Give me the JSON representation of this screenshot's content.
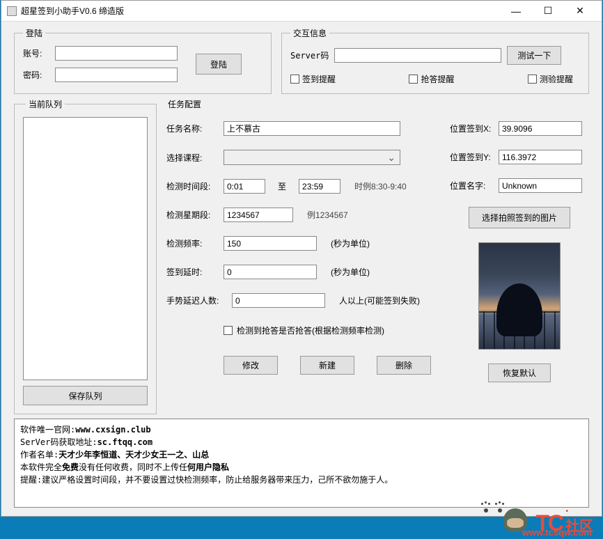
{
  "titlebar": {
    "title": "超星签到小助手V0.6 缔造版"
  },
  "login": {
    "legend": "登陆",
    "account_label": "账号:",
    "password_label": "密码:",
    "login_btn": "登陆"
  },
  "interact": {
    "legend": "交互信息",
    "server_label": "Server码",
    "test_btn": "测试一下",
    "chk_signin": "签到提醒",
    "chk_answer": "抢答提醒",
    "chk_test": "测验提醒"
  },
  "queue": {
    "legend": "当前队列",
    "save_btn": "保存队列"
  },
  "task": {
    "legend": "任务配置",
    "name_label": "任务名称:",
    "name_value": "上不慕古",
    "course_label": "选择课程:",
    "time_label": "检测时间段:",
    "time_start": "0:01",
    "time_to": "至",
    "time_end": "23:59",
    "time_example": "时例8:30-9:40",
    "weekday_label": "检测星期段:",
    "weekday_value": "1234567",
    "weekday_example": "例1234567",
    "freq_label": "检测频率:",
    "freq_value": "150",
    "freq_unit": "(秒为单位)",
    "delay_label": "签到延时:",
    "delay_value": "0",
    "delay_unit": "(秒为单位)",
    "count_label": "手势延迟人数:",
    "count_value": "0",
    "count_suffix": "人以上(可能签到失败)",
    "auto_answer": "检测到抢答是否抢答(根据检测频率检测)",
    "btn_modify": "修改",
    "btn_new": "新建",
    "btn_delete": "删除"
  },
  "position": {
    "x_label": "位置签到X:",
    "x_value": "39.9096",
    "y_label": "位置签到Y:",
    "y_value": "116.3972",
    "name_label": "位置名字:",
    "name_value": "Unknown",
    "photo_btn": "选择拍照签到的图片",
    "restore_btn": "恢复默认"
  },
  "info": {
    "line1_prefix": "软件唯一官网:",
    "line1_url": "www.cxsign.club",
    "line2_prefix": "SerVer码获取地址:",
    "line2_url": "sc.ftqq.com",
    "line3_prefix": "作者名单:",
    "line3_names": "天才少年李恒道、天才少女王一之、山总",
    "line4_a": "本软件完全",
    "line4_b": "免费",
    "line4_c": "没有任何收费，同时不上传任",
    "line4_d": "何用户隐私",
    "line5": "提醒:建议严格设置时间段，并不要设置过快检测频率，防止给服务器带来压力，己所不欲勿施于人。"
  },
  "footer": {
    "brand": "TC",
    "suffix": "社区",
    "url": "www.tcsqw.com"
  }
}
